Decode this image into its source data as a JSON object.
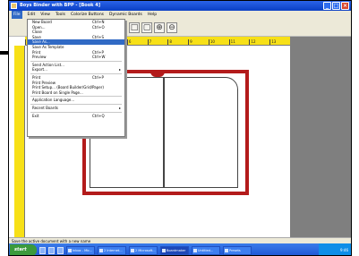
{
  "window": {
    "title": "Boys Binder with BPP - [Book 4]"
  },
  "menubar": {
    "items": [
      "File",
      "Edit",
      "View",
      "Tools",
      "Colorize Buttons",
      "Dynamic Boards",
      "Help"
    ]
  },
  "file_menu": {
    "items": [
      {
        "label": "New Board",
        "shortcut": "Ctrl+N"
      },
      {
        "label": "Open...",
        "shortcut": "Ctrl+O"
      },
      {
        "label": "Close",
        "shortcut": ""
      },
      {
        "label": "Save",
        "shortcut": "Ctrl+S"
      },
      {
        "label": "Save As...",
        "shortcut": ""
      },
      {
        "label": "Save As Template",
        "shortcut": ""
      },
      {
        "label": "Print",
        "shortcut": "Ctrl+P"
      },
      {
        "label": "Preview",
        "shortcut": "Ctrl+W"
      },
      {
        "label": "Send Action List...",
        "shortcut": ""
      },
      {
        "label": "Export...",
        "shortcut": ""
      },
      {
        "label": "Print",
        "shortcut": "Ctrl+P"
      },
      {
        "label": "Print Preview",
        "shortcut": ""
      },
      {
        "label": "Print Setup... (Board Builder/Grid/Paper)",
        "shortcut": ""
      },
      {
        "label": "Print Board on Single Page...",
        "shortcut": ""
      },
      {
        "label": "Application Language...",
        "shortcut": ""
      },
      {
        "label": "Recent Boards",
        "shortcut": ""
      },
      {
        "label": "Exit",
        "shortcut": "Ctrl+Q"
      }
    ],
    "highlighted_index": 4
  },
  "ruler": {
    "ticks": [
      "1",
      "2",
      "3",
      "4",
      "5",
      "6",
      "7",
      "8",
      "9",
      "10",
      "11",
      "12",
      "13"
    ]
  },
  "status": {
    "text": "Save the active document with a new name"
  },
  "taskbar": {
    "start_label": "start",
    "tasks": [
      "Inbox - Mic...",
      "2 Internet...",
      "2 Microsoft...",
      "Boardmaker",
      "Untitled...",
      "Presets"
    ],
    "clock": "9:46"
  },
  "colors": {
    "accent": "#316ac5",
    "book_border": "#b31b1b",
    "ruler": "#f7e017",
    "titlebar": "#0a3fc4"
  }
}
